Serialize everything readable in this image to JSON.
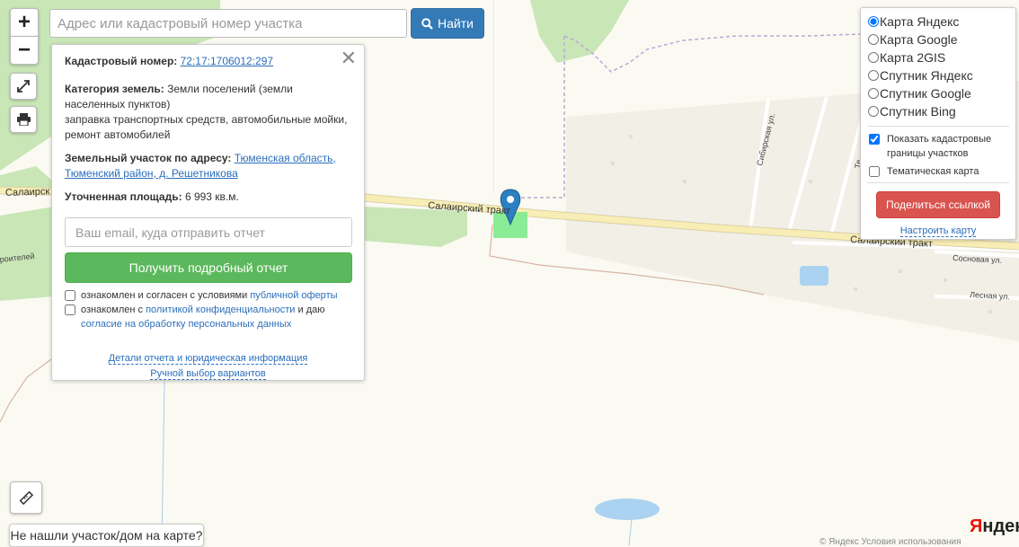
{
  "search": {
    "placeholder": "Адрес или кадастровый номер участка",
    "button_label": "Найти"
  },
  "zoom": {
    "plus": "+",
    "minus": "−"
  },
  "info": {
    "cadastral_label": "Кадастровый номер:",
    "cadastral_value": "72:17:1706012:297",
    "category_label": "Категория земель:",
    "category_value": "Земли поселений (земли населенных пунктов)",
    "category_use": "заправка транспортных средств, автомобильные мойки, ремонт автомобилей",
    "address_label": "Земельный участок по адресу:",
    "address_value": "Тюменская область, Тюменский район, д. Решетникова",
    "area_label": "Уточненная площадь:",
    "area_value": "6 993 кв.м.",
    "email_placeholder": "Ваш email, куда отправить отчет",
    "report_button": "Получить подробный отчет",
    "agree1_text": "ознакомлен и согласен с условиями",
    "agree1_link": "публичной оферты",
    "agree2_text": "ознакомлен с",
    "agree2_link": "политикой конфиденциальности",
    "agree2_mid": "и даю",
    "agree2_link2": "согласие на обработку персональных данных",
    "details_link": "Детали отчета и юридическая информация",
    "manual_link": "Ручной выбор вариантов"
  },
  "layers": {
    "options": [
      {
        "label": "Карта Яндекс",
        "checked": true
      },
      {
        "label": "Карта Google",
        "checked": false
      },
      {
        "label": "Карта 2GIS",
        "checked": false
      },
      {
        "label": "Спутник Яндекс",
        "checked": false
      },
      {
        "label": "Спутник Google",
        "checked": false
      },
      {
        "label": "Спутник Bing",
        "checked": false
      }
    ],
    "show_boundaries": "Показать кадастровые границы участков",
    "show_boundaries_checked": true,
    "thematic": "Тематическая карта",
    "thematic_checked": false,
    "share_button": "Поделиться ссылкой",
    "config_link": "Настроить карту"
  },
  "map_labels": {
    "salair_left": "Салаирск",
    "salair_mid": "Салаирский тракт",
    "salair_right": "Салаирский тракт",
    "stroiteley": "роителей",
    "sibirskaya": "Сибирская ул.",
    "sosnovaya": "Сосновая ул.",
    "lesnaya": "Лесная ул.",
    "te": "Те"
  },
  "not_found": "Не нашли участок/дом на карте?",
  "yandex_logo_y": "Я",
  "yandex_logo_rest": "ндекс",
  "copyright": "© Яндекс  Условия использования",
  "colors": {
    "accent_blue": "#337ab7",
    "green_button": "#5cb85c",
    "red_button": "#d9534f",
    "plot_fill": "#7dea8c",
    "marker": "#2c7fc0"
  }
}
